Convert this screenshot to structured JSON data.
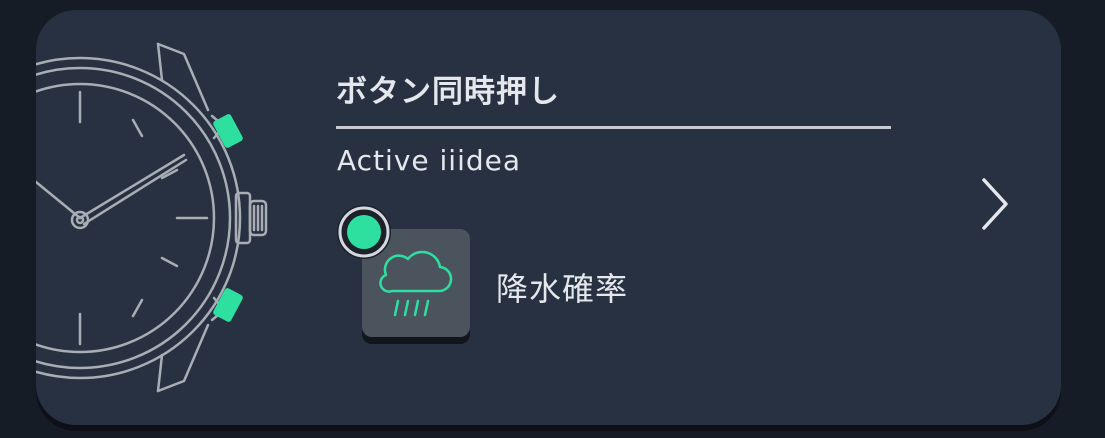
{
  "card": {
    "title": "ボタン同時押し",
    "subtitle": "Active iiidea"
  },
  "feature": {
    "label": "降水確率",
    "icon": "cloud-rain-icon",
    "status": "active"
  },
  "colors": {
    "background": "#151c25",
    "card": "#283141",
    "accent": "#2ee0a0",
    "tile": "#4b535d",
    "text": "#e4e7eb"
  }
}
